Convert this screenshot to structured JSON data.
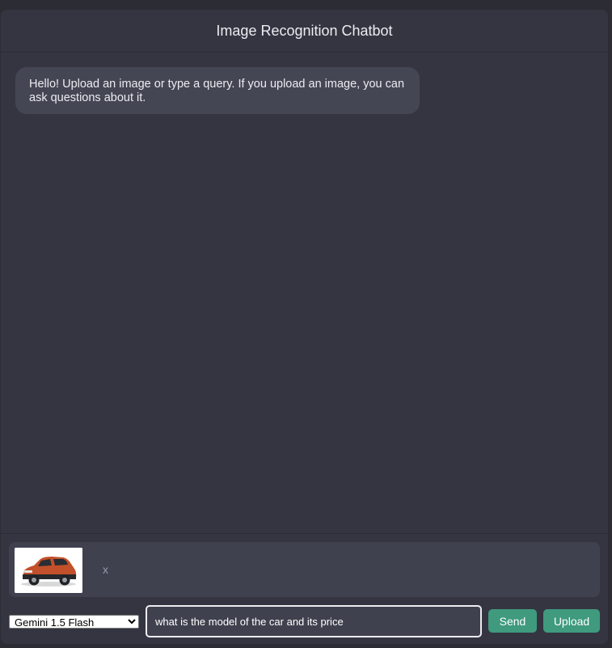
{
  "header": {
    "title": "Image Recognition Chatbot"
  },
  "messages": [
    {
      "role": "bot",
      "text": "Hello! Upload an image or type a query. If you upload an image, you can ask questions about it."
    }
  ],
  "preview": {
    "remove_label": "x",
    "thumbnail_icon": "car-image"
  },
  "controls": {
    "model_selected": "Gemini 1.5 Flash",
    "query_value": "what is the model of the car and its price",
    "send_label": "Send",
    "upload_label": "Upload"
  },
  "colors": {
    "background": "#343541",
    "bubble": "#444654",
    "accent": "#3f9a7e",
    "text": "#ececf1"
  }
}
